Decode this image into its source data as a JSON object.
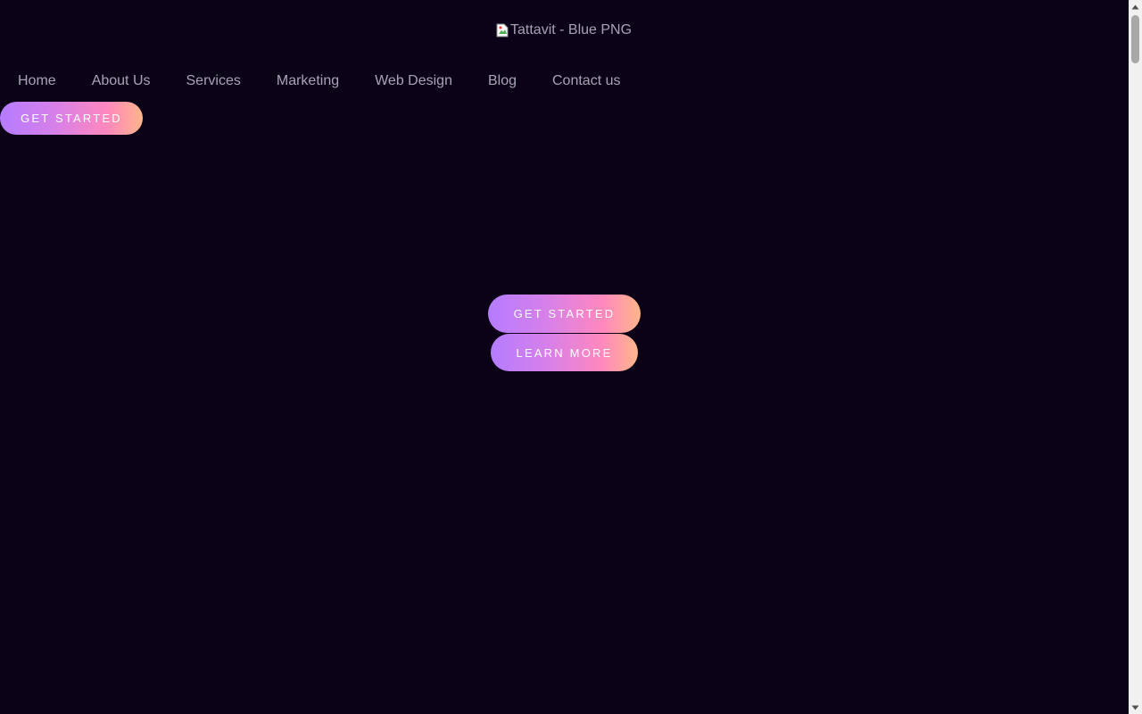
{
  "header": {
    "logo_alt": "Tattavit - Blue PNG",
    "nav": [
      {
        "label": "Home"
      },
      {
        "label": "About Us"
      },
      {
        "label": "Services"
      },
      {
        "label": "Marketing"
      },
      {
        "label": "Web Design"
      },
      {
        "label": "Blog"
      },
      {
        "label": "Contact us"
      }
    ],
    "cta_label": "GET STARTED"
  },
  "hero": {
    "primary_label": "GET STARTED",
    "secondary_label": "LEARN MORE"
  },
  "colors": {
    "background": "#0b0218",
    "nav_text": "#a8a4b4",
    "button_gradient_start": "#b57cff",
    "button_gradient_mid": "#ff88bd",
    "button_gradient_end": "#ffb58a"
  },
  "icons": {
    "logo": "broken-image-icon",
    "scroll_up": "triangle-up-icon",
    "scroll_down": "triangle-down-icon"
  }
}
